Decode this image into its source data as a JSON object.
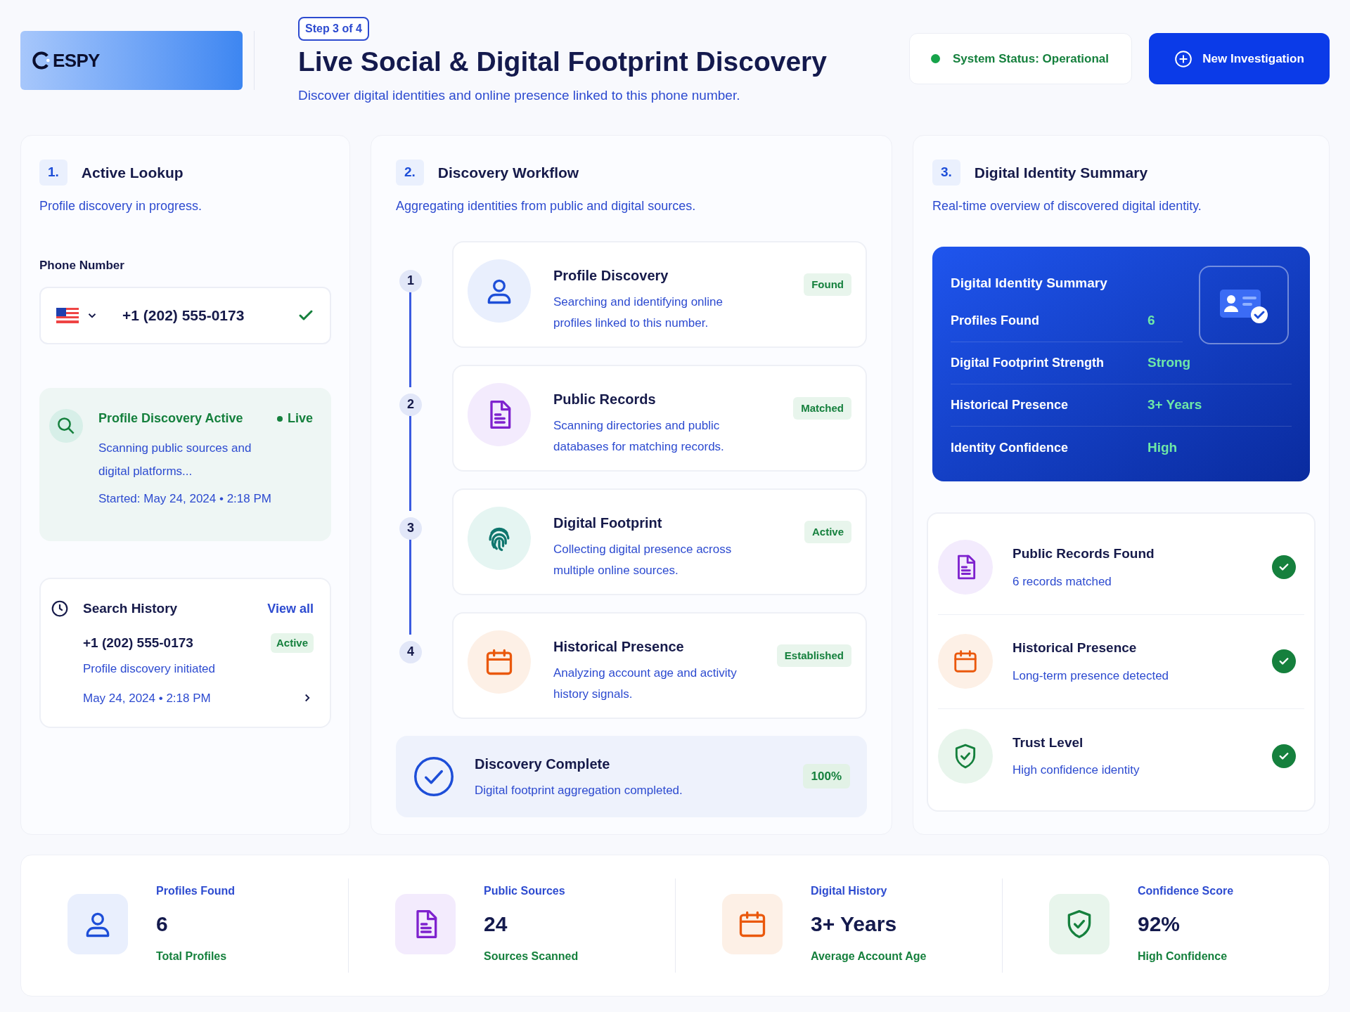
{
  "header": {
    "logo": "ESPY",
    "step": "Step 3 of 4",
    "title": "Live Social & Digital Footprint Discovery",
    "subtitle": "Discover digital identities and online presence linked to this phone number.",
    "status": {
      "label": "System Status: Operational",
      "color": "#16a34a"
    },
    "new_button": "New Investigation"
  },
  "lookup": {
    "number": "1.",
    "title": "Active Lookup",
    "subtitle": "Profile discovery in progress.",
    "phone_label": "Phone Number",
    "phone": {
      "value": "+1 (202) 555-0173",
      "verified": true
    },
    "activity": {
      "title": "Profile Discovery Active",
      "live": "Live",
      "description": "Scanning public sources and digital platforms...",
      "started": "Started: May 24, 2024 • 2:18 PM"
    },
    "history": {
      "title": "Search History",
      "view_all": "View all",
      "entries": [
        {
          "phone": "+1 (202) 555-0173",
          "status": "Active",
          "note": "Profile discovery initiated",
          "time": "May 24, 2024 • 2:18 PM"
        }
      ]
    }
  },
  "workflow": {
    "number": "2.",
    "title": "Discovery Workflow",
    "subtitle": "Aggregating identities from public and digital sources.",
    "steps": [
      {
        "step": "1",
        "kind": "profile",
        "title": "Profile Discovery",
        "description": "Searching and identifying online profiles linked to this number.",
        "status": "Found"
      },
      {
        "step": "2",
        "kind": "records",
        "title": "Public Records",
        "description": "Scanning directories and public databases for matching records.",
        "status": "Matched"
      },
      {
        "step": "3",
        "kind": "fingerprint",
        "title": "Digital Footprint",
        "description": "Collecting digital presence across multiple online sources.",
        "status": "Active"
      },
      {
        "step": "4",
        "kind": "calendar",
        "title": "Historical Presence",
        "description": "Analyzing account age and activity history signals.",
        "status": "Established"
      }
    ],
    "complete": {
      "title": "Discovery Complete",
      "description": "Digital footprint aggregation completed.",
      "percent": "100%"
    }
  },
  "summary": {
    "number": "3.",
    "title": "Digital Identity Summary",
    "subtitle": "Real-time overview of discovered digital identity.",
    "card": {
      "title": "Digital Identity Summary",
      "rows": [
        {
          "label": "Profiles Found",
          "value": "6"
        },
        {
          "label": "Digital Footprint Strength",
          "value": "Strong"
        },
        {
          "label": "Historical Presence",
          "value": "3+ Years"
        },
        {
          "label": "Identity Confidence",
          "value": "High"
        }
      ]
    },
    "checks": [
      {
        "kind": "records",
        "title": "Public Records Found",
        "detail": "6 records matched",
        "checked": true
      },
      {
        "kind": "calendar",
        "title": "Historical Presence",
        "detail": "Long-term presence detected",
        "checked": true
      },
      {
        "kind": "shield",
        "title": "Trust Level",
        "detail": "High confidence identity",
        "checked": true
      }
    ]
  },
  "stats": [
    {
      "kind": "profile",
      "label": "Profiles Found",
      "value": "6",
      "note": "Total Profiles"
    },
    {
      "kind": "records",
      "label": "Public Sources",
      "value": "24",
      "note": "Sources Scanned"
    },
    {
      "kind": "calendar",
      "label": "Digital History",
      "value": "3+ Years",
      "note": "Average Account Age"
    },
    {
      "kind": "shield",
      "label": "Confidence Score",
      "value": "92%",
      "note": "High Confidence"
    }
  ]
}
